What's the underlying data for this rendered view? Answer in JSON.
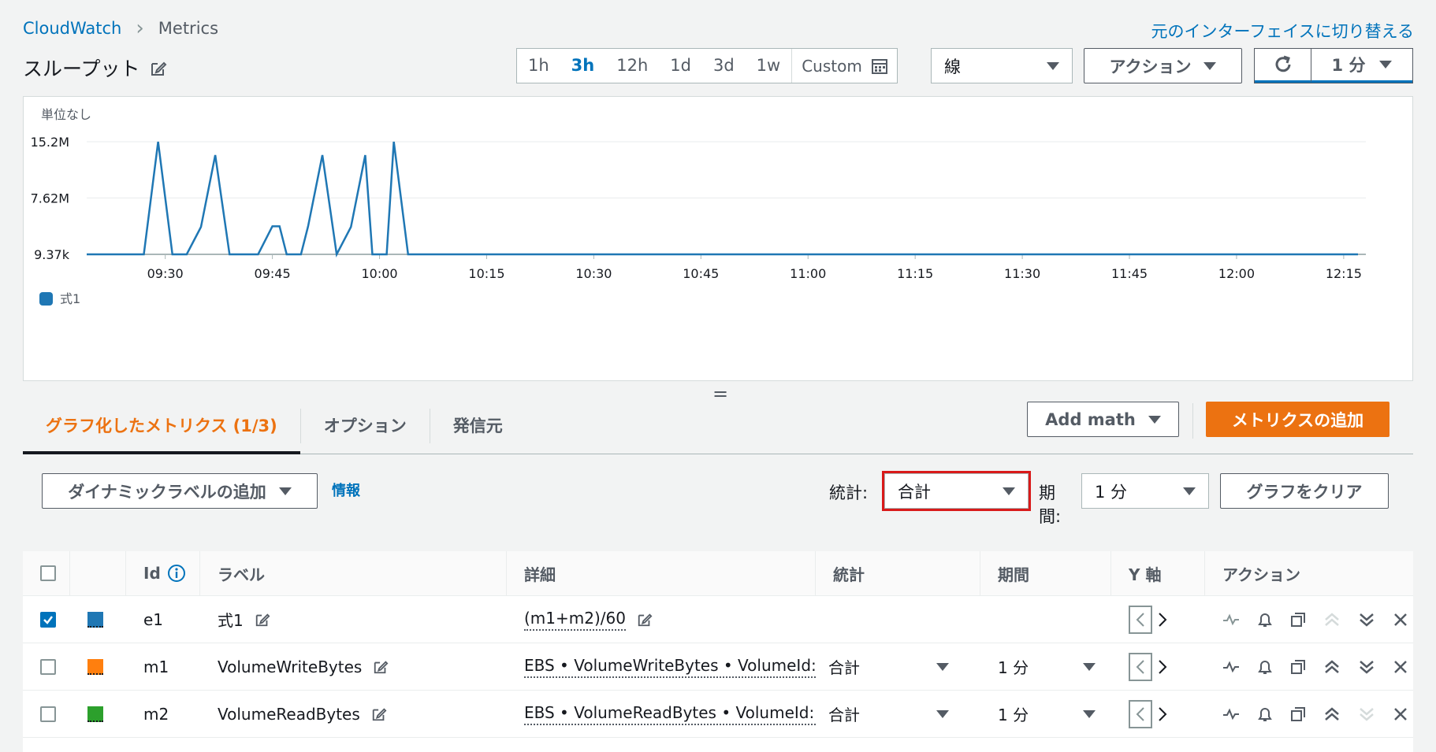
{
  "header": {
    "breadcrumb": [
      "CloudWatch",
      "Metrics"
    ],
    "switch_link": "元のインターフェイスに切り替える",
    "title": "スループット"
  },
  "time_range": {
    "options": [
      "1h",
      "3h",
      "12h",
      "1d",
      "3d",
      "1w"
    ],
    "active": "3h",
    "custom_label": "Custom"
  },
  "graph_type": {
    "value": "線"
  },
  "actions_button": "アクション",
  "refresh_interval": "1 分",
  "chart_data": {
    "type": "line",
    "ylabel": "単位なし",
    "y_ticks": [
      "15.2M",
      "7.62M",
      "9.37k"
    ],
    "x_ticks": [
      "09:30",
      "09:45",
      "10:00",
      "10:15",
      "10:30",
      "10:45",
      "11:00",
      "11:15",
      "11:30",
      "11:45",
      "12:00",
      "12:15"
    ],
    "series": [
      {
        "name": "式1",
        "color": "#1f77b4",
        "x": [
          "09:19",
          "09:25",
          "09:27",
          "09:29",
          "09:31",
          "09:33",
          "09:35",
          "09:37",
          "09:39",
          "09:41",
          "09:43",
          "09:45",
          "09:46",
          "09:47",
          "09:49",
          "09:50",
          "09:52",
          "09:54",
          "09:56",
          "09:58",
          "09:59",
          "10:00",
          "10:01",
          "10:02",
          "10:04",
          "10:05",
          "10:10",
          "10:30",
          "11:00",
          "11:30",
          "12:00",
          "12:17"
        ],
        "y": [
          9370,
          9370,
          9370,
          15200000,
          9370,
          9370,
          3700000,
          13400000,
          9370,
          9370,
          9370,
          3800000,
          3800000,
          9370,
          9370,
          3800000,
          13400000,
          9370,
          3700000,
          13400000,
          9370,
          9370,
          9370,
          15200000,
          9370,
          9370,
          9370,
          9370,
          9370,
          9370,
          9370,
          9370
        ]
      }
    ],
    "legend": "bottom-left",
    "grid": true
  },
  "tabs": [
    {
      "label": "グラフ化したメトリクス (1/3)",
      "active": true
    },
    {
      "label": "オプション",
      "active": false
    },
    {
      "label": "発信元",
      "active": false
    }
  ],
  "add_math": "Add math",
  "add_metrics": "メトリクスの追加",
  "toolbar": {
    "dynamic_label": "ダイナミックラベルの追加",
    "info": "情報",
    "stat_label": "統計:",
    "stat_value": "合計",
    "period_label_1": "期",
    "period_label_2": "間:",
    "period_value": "1 分",
    "clear_graph": "グラフをクリア"
  },
  "table": {
    "headers": [
      "Id",
      "ラベル",
      "詳細",
      "統計",
      "期間",
      "Y 軸",
      "アクション"
    ],
    "rows": [
      {
        "checked": true,
        "color": "#1f77b4",
        "id": "e1",
        "label": "式1",
        "details": "(m1+m2)/60",
        "stat": "",
        "period": ""
      },
      {
        "checked": false,
        "color": "#ff7f0e",
        "id": "m1",
        "label": "VolumeWriteBytes",
        "details": "EBS • VolumeWriteBytes • VolumeId: vc",
        "stat": "合計",
        "period": "1 分"
      },
      {
        "checked": false,
        "color": "#2ca02c",
        "id": "m2",
        "label": "VolumeReadBytes",
        "details": "EBS • VolumeReadBytes • VolumeId: vo",
        "stat": "合計",
        "period": "1 分"
      }
    ]
  }
}
